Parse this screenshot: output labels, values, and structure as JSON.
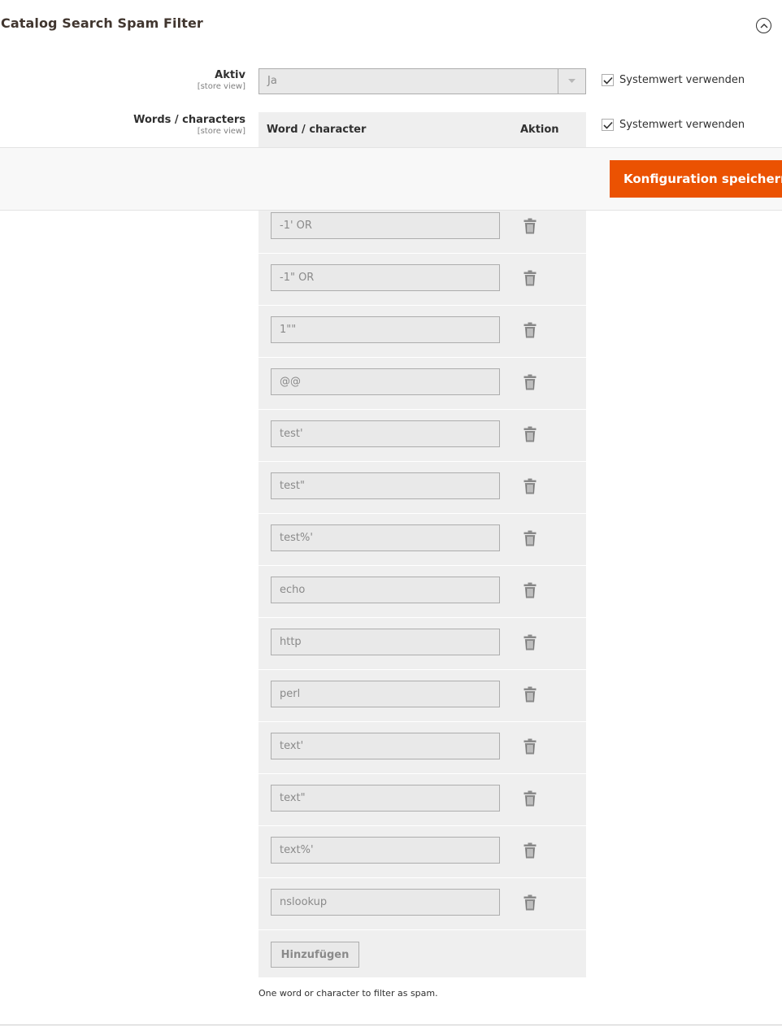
{
  "section": {
    "title": "Catalog Search Spam Filter"
  },
  "fields": {
    "aktiv": {
      "label": "Aktiv",
      "scope": "[store view]",
      "value": "Ja",
      "system_value_label": "Systemwert verwenden",
      "system_value_checked": true
    },
    "words": {
      "label": "Words / characters",
      "scope": "[store view]",
      "system_value_label": "Systemwert verwenden",
      "system_value_checked": true,
      "columns": [
        "Word / character",
        "Aktion"
      ],
      "rows": [
        "-1' OR",
        "-1\" OR",
        "1\"\"",
        "@@",
        "test'",
        "test\"",
        "test%'",
        "echo",
        "http",
        "perl",
        "text'",
        "text\"",
        "text%'",
        "nslookup"
      ],
      "add_label": "Hinzufügen",
      "note": "One word or character to filter as spam."
    }
  },
  "toolbar": {
    "save_label": "Konfiguration speichern"
  },
  "colors": {
    "accent": "#eb5202"
  },
  "icons": {
    "collapse": "chevron-up-circle-icon",
    "select_arrow": "caret-down-icon",
    "check": "check-icon",
    "delete": "trash-icon"
  }
}
